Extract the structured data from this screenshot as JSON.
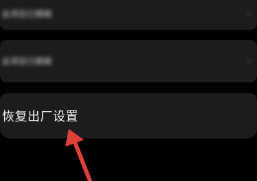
{
  "settings": {
    "items": [
      {
        "label": "此项目已模糊",
        "blurred": true
      },
      {
        "label": "此项目已模糊",
        "blurred": true
      },
      {
        "label": "恢复出厂设置",
        "blurred": false
      }
    ]
  },
  "annotation": {
    "arrow_color": "#e0413b"
  },
  "colors": {
    "background": "#000000",
    "row_background": "#1c1c1e",
    "text": "#f2f2f2"
  }
}
